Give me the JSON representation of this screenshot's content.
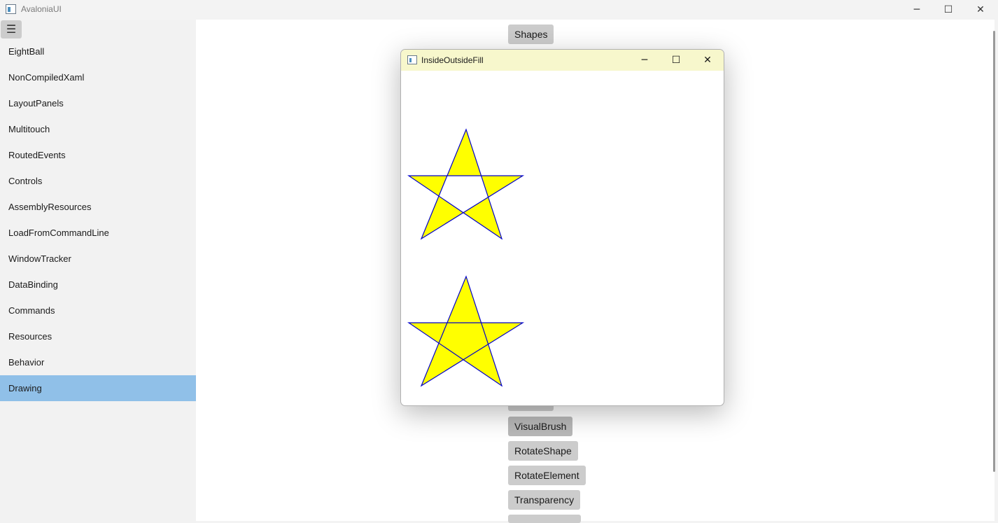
{
  "app": {
    "title": "AvaloniaUI",
    "icon": "app-icon"
  },
  "window_controls": {
    "minimize": "─",
    "maximize": "☐",
    "close": "✕"
  },
  "sidebar": {
    "menu_icon": "☰",
    "items": [
      {
        "label": "EightBall"
      },
      {
        "label": "NonCompiledXaml"
      },
      {
        "label": "LayoutPanels"
      },
      {
        "label": "Multitouch"
      },
      {
        "label": "RoutedEvents"
      },
      {
        "label": "Controls"
      },
      {
        "label": "AssemblyResources"
      },
      {
        "label": "LoadFromCommandLine"
      },
      {
        "label": "WindowTracker"
      },
      {
        "label": "DataBinding"
      },
      {
        "label": "Commands"
      },
      {
        "label": "Resources"
      },
      {
        "label": "Behavior"
      },
      {
        "label": "Drawing",
        "selected": true
      }
    ]
  },
  "main": {
    "buttons": [
      {
        "label": "Shapes"
      },
      {
        "label": "VisualBrush"
      },
      {
        "label": "RotateShape"
      },
      {
        "label": "RotateElement"
      },
      {
        "label": "Transparency"
      }
    ]
  },
  "dialog": {
    "title": "InsideOutsideFill",
    "icon": "window-icon",
    "controls": {
      "minimize": "─",
      "maximize": "☐",
      "close": "✕"
    },
    "stars": [
      {
        "fill_rule": "evenodd",
        "fill": "#ffff00",
        "stroke": "#0000cc"
      },
      {
        "fill_rule": "nonzero",
        "fill": "#ffff00",
        "stroke": "#0000cc"
      }
    ]
  }
}
